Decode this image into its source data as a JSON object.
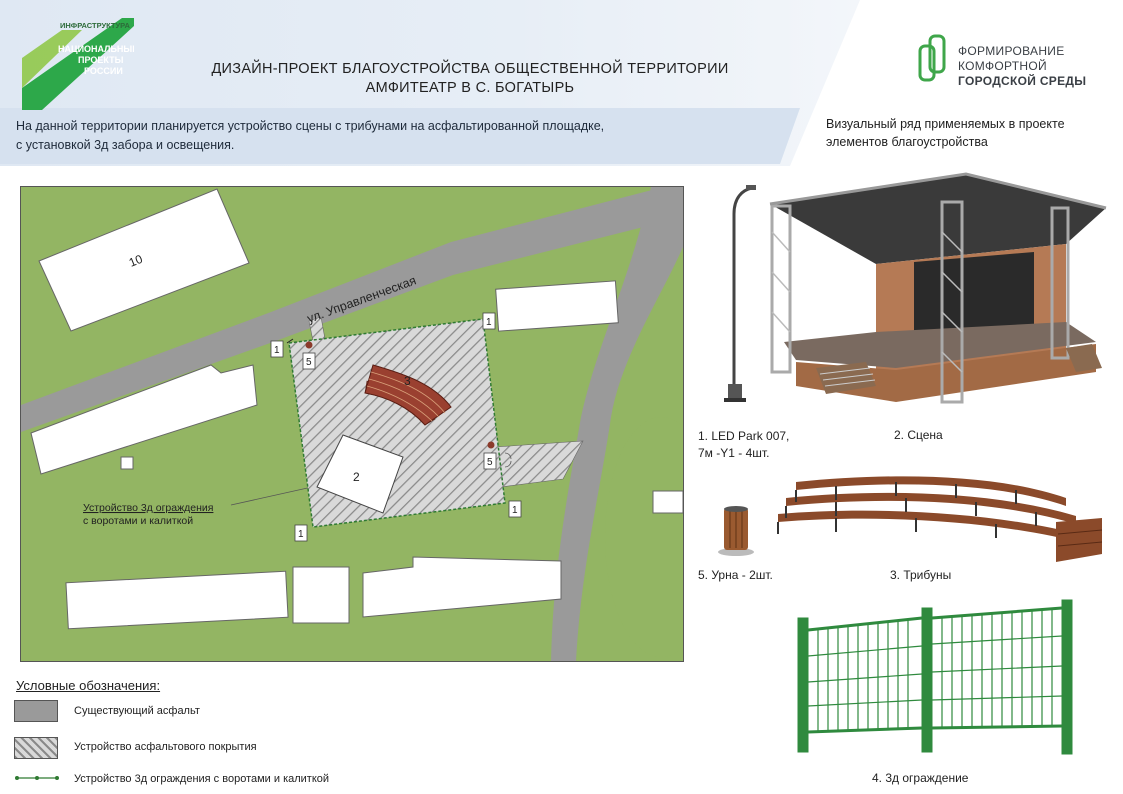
{
  "header": {
    "logo_np": {
      "top": "ИНФРАСТРУКТУРА",
      "line1": "НАЦИОНАЛЬНЫЕ",
      "line2": "ПРОЕКТЫ",
      "line3": "РОССИИ"
    },
    "title_line1": "ДИЗАЙН-ПРОЕКТ БЛАГОУСТРОЙСТВА ОБЩЕСТВЕННОЙ ТЕРРИТОРИИ",
    "title_line2": "АМФИТЕАТР В С. БОГАТЫРЬ",
    "logo_fks": {
      "line1": "ФОРМИРОВАНИЕ",
      "line2": "КОМФОРТНОЙ",
      "line3": "ГОРОДСКОЙ СРЕДЫ"
    }
  },
  "description": {
    "line1": "На данной территории планируется устройство сцены с трибунами на асфальтированной площадке,",
    "line2": "с установкой 3д забора и освещения."
  },
  "visual": {
    "title_line1": "Визуальный ряд применяемых в проекте",
    "title_line2": "элементов благоустройства"
  },
  "map": {
    "street": "ул. Управленческая",
    "building_10": "10",
    "stage_num": "2",
    "stands_num": "3",
    "lamp_nums": [
      "1",
      "1",
      "1",
      "1"
    ],
    "urn_nums": [
      "5",
      "5"
    ],
    "fence_note_line1": "Устройство 3д ограждения",
    "fence_note_line2": "с воротами и калиткой"
  },
  "items": {
    "lamp_line1": "1. LED Park 007,",
    "lamp_line2": "7м -Y1 - 4шт.",
    "stage": "2. Сцена",
    "urn": "5. Урна - 2шт.",
    "stands": "3. Трибуны",
    "fence": "4. 3д ограждение"
  },
  "legend": {
    "title": "Условные обозначения:",
    "asphalt_existing": "Существующий асфальт",
    "asphalt_new": "Устройство асфальтового покрытия",
    "fence": "Устройство 3д ограждения с воротами и калиткой"
  },
  "colors": {
    "grass": "#93b563",
    "asphalt": "#9a9a9a",
    "fence_green": "#2f8a3e",
    "wood": "#8b4a2a",
    "header_blue": "#dfe8f3"
  }
}
